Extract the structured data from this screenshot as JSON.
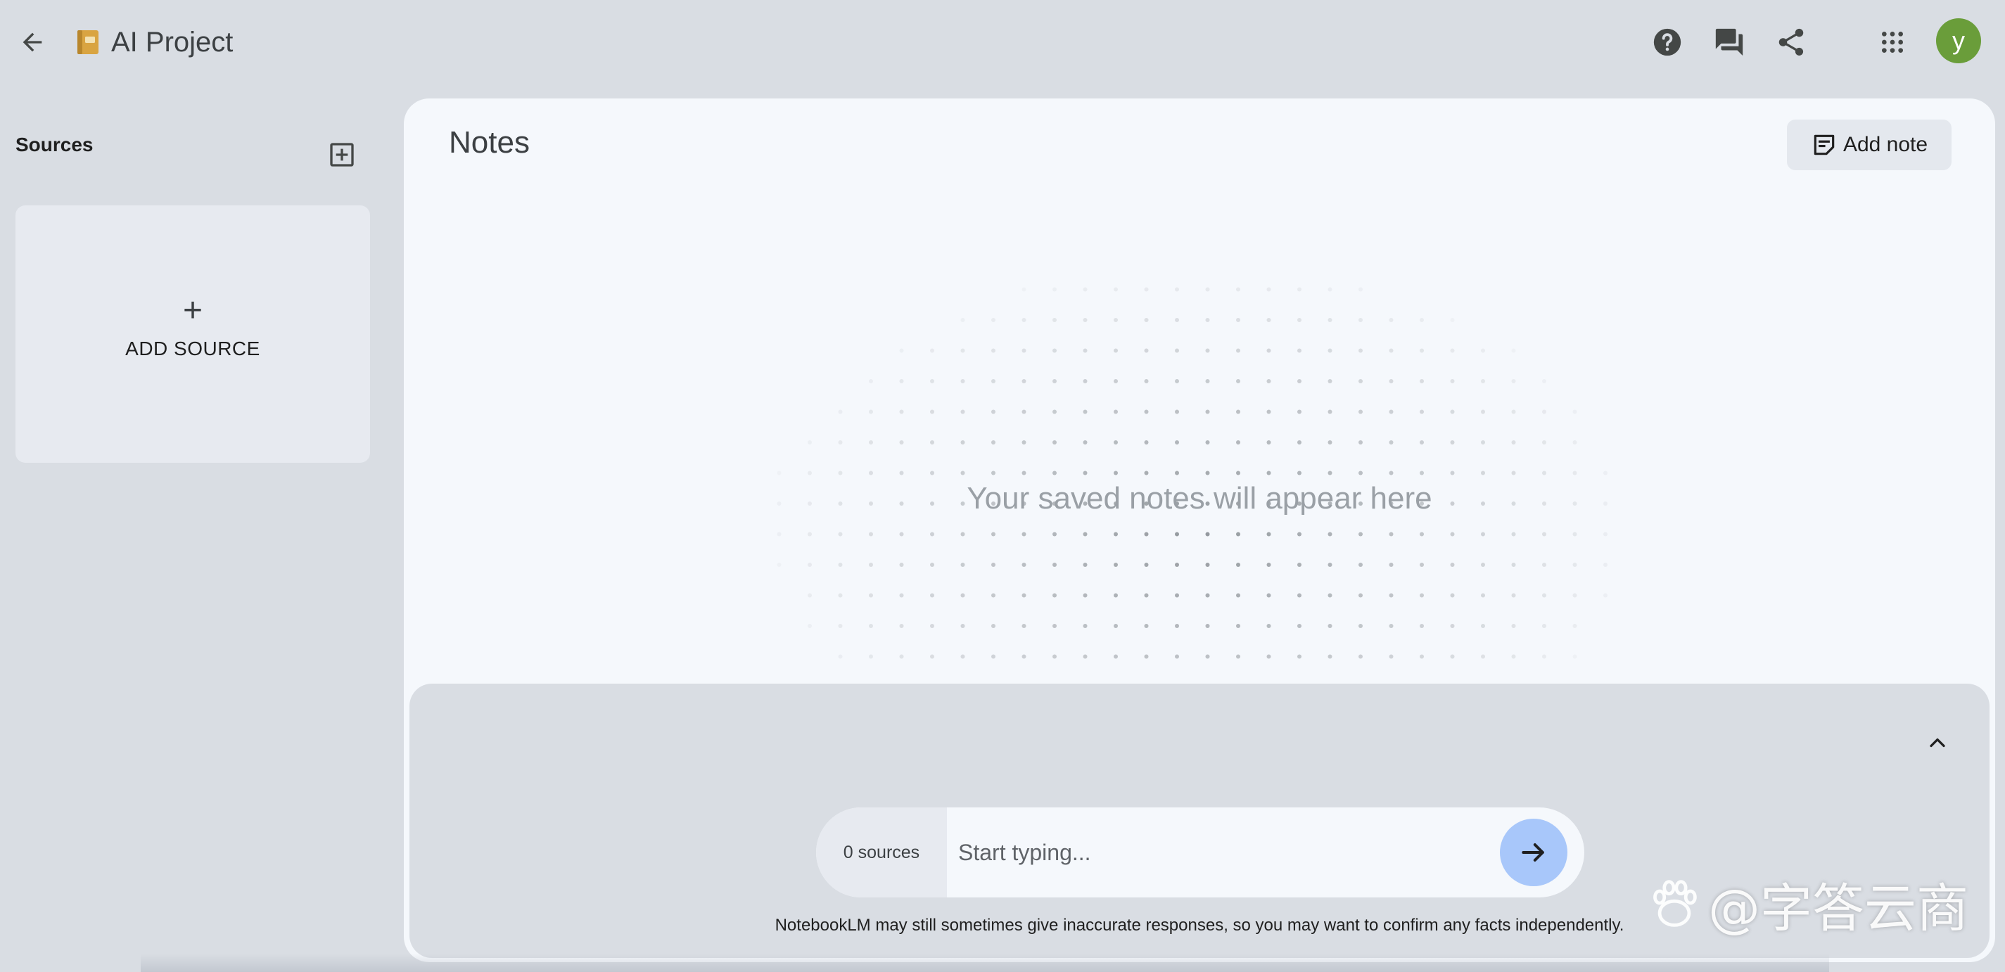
{
  "header": {
    "title": "AI Project",
    "icons": [
      "back-arrow-icon",
      "notebook-icon",
      "help-icon",
      "chat-feedback-icon",
      "share-icon",
      "apps-grid-icon"
    ],
    "avatar_letter": "y"
  },
  "sources": {
    "title": "Sources",
    "add_card_plus": "+",
    "add_card_label": "ADD SOURCE"
  },
  "notes": {
    "title": "Notes",
    "add_note_label": "Add note",
    "empty_message": "Your saved notes will appear here"
  },
  "chat": {
    "source_count": "0 sources",
    "input_placeholder": "Start typing...",
    "input_value": "",
    "disclaimer": "NotebookLM may still sometimes give inaccurate responses, so you may want to confirm any facts independently."
  },
  "watermark": {
    "text": "@字答云商"
  },
  "colors": {
    "page_background": "#d9dde3",
    "panel_background": "#f5f8fc",
    "avatar": "#6a9d3a",
    "send_button": "#a8c7fa",
    "card": "#e7eaf0"
  }
}
